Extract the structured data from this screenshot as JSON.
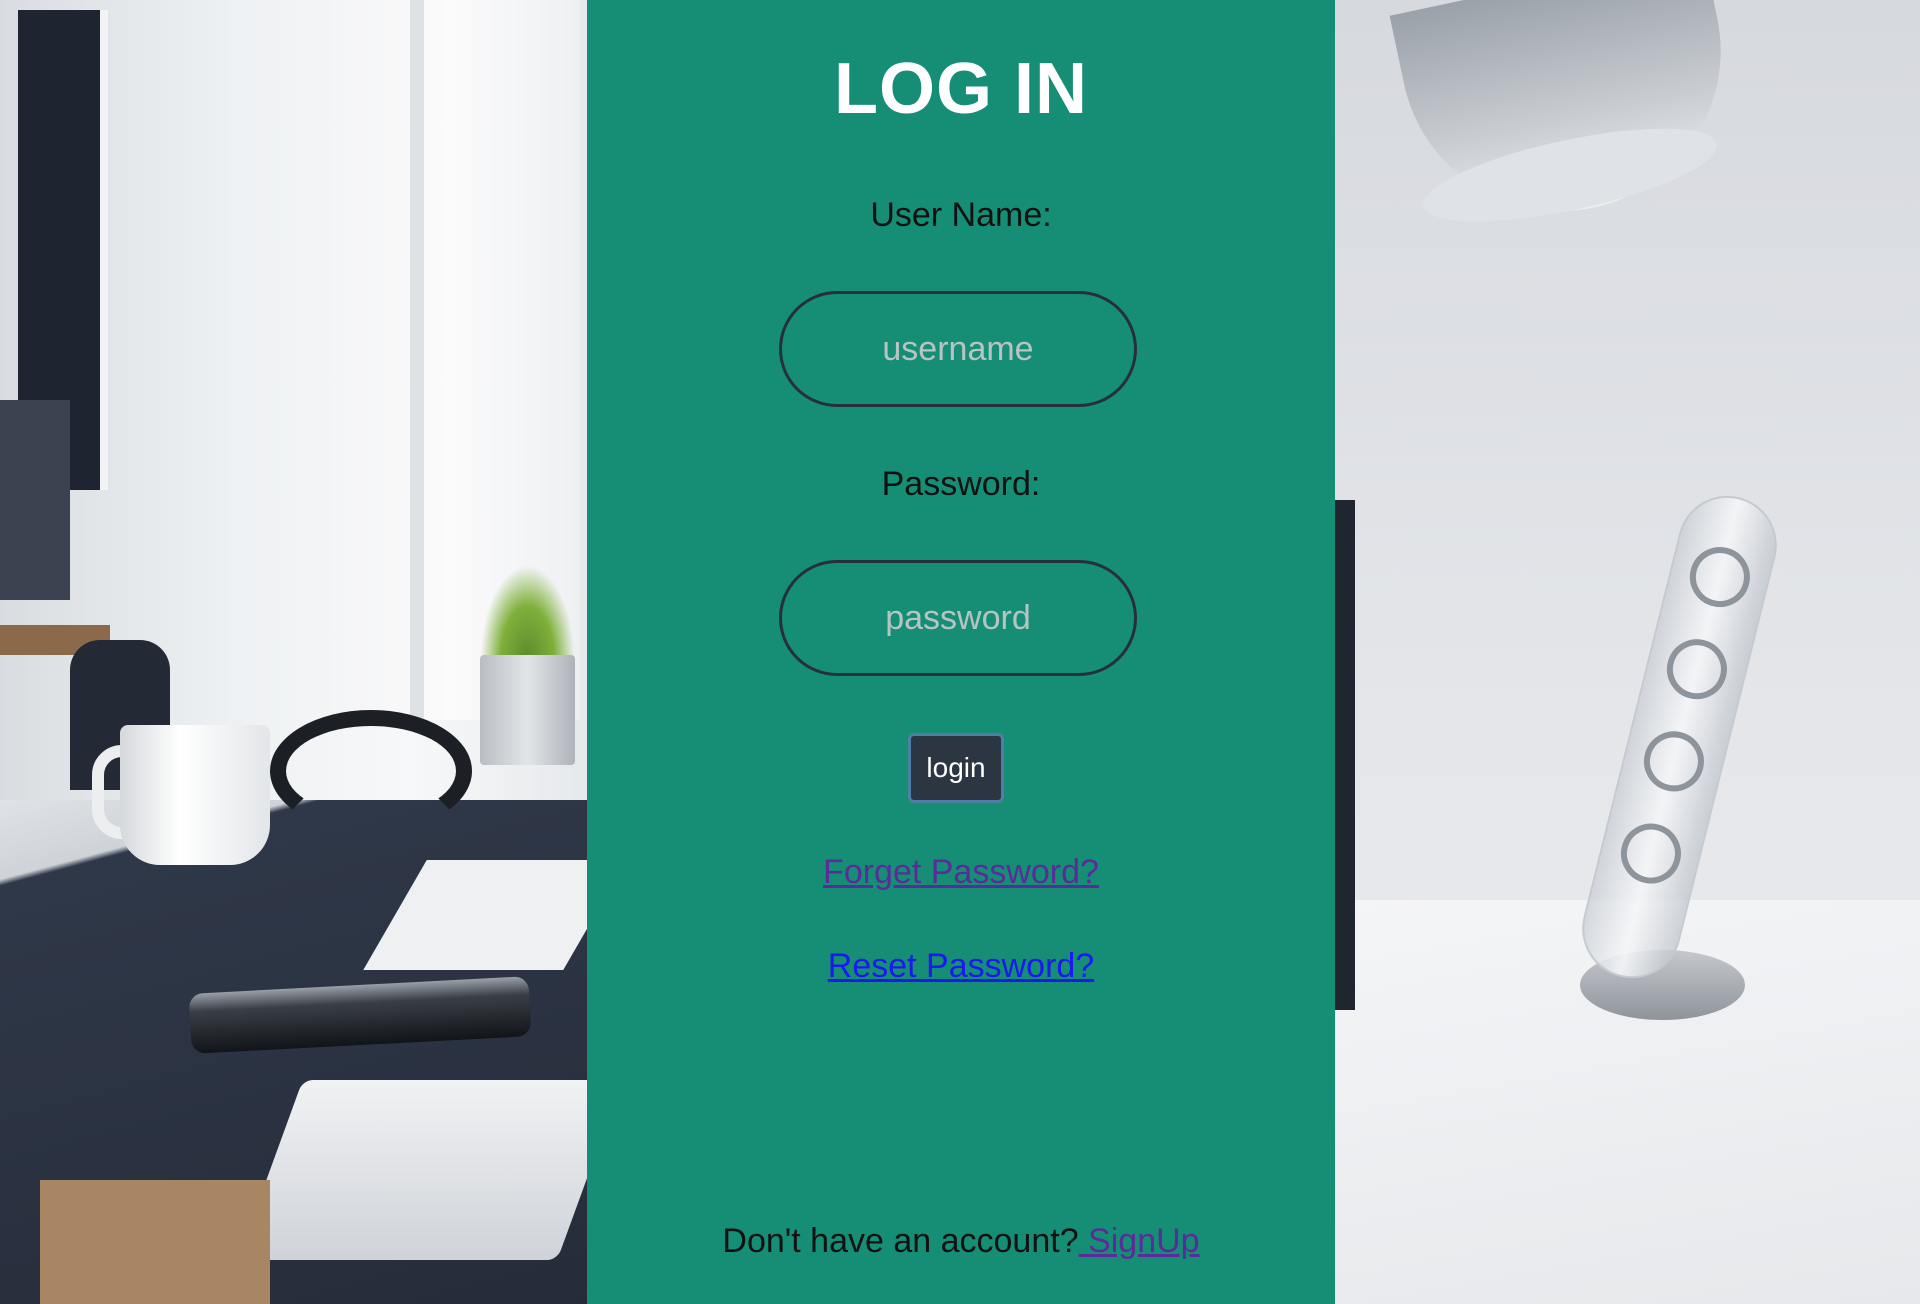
{
  "login": {
    "title": "LOG IN",
    "username_label": "User Name:",
    "username_placeholder": "username",
    "password_label": "Password:",
    "password_placeholder": "password",
    "login_button": "login",
    "forget_password_link": "Forget Password?",
    "reset_password_link": "Reset Password?",
    "footer_text": "Don't have an account?",
    "signup_link": " SignUp"
  },
  "colors": {
    "panel_background": "#168e76",
    "button_background": "#2c3542",
    "visited_link": "#5b2b9a",
    "link": "#1a1aee"
  }
}
